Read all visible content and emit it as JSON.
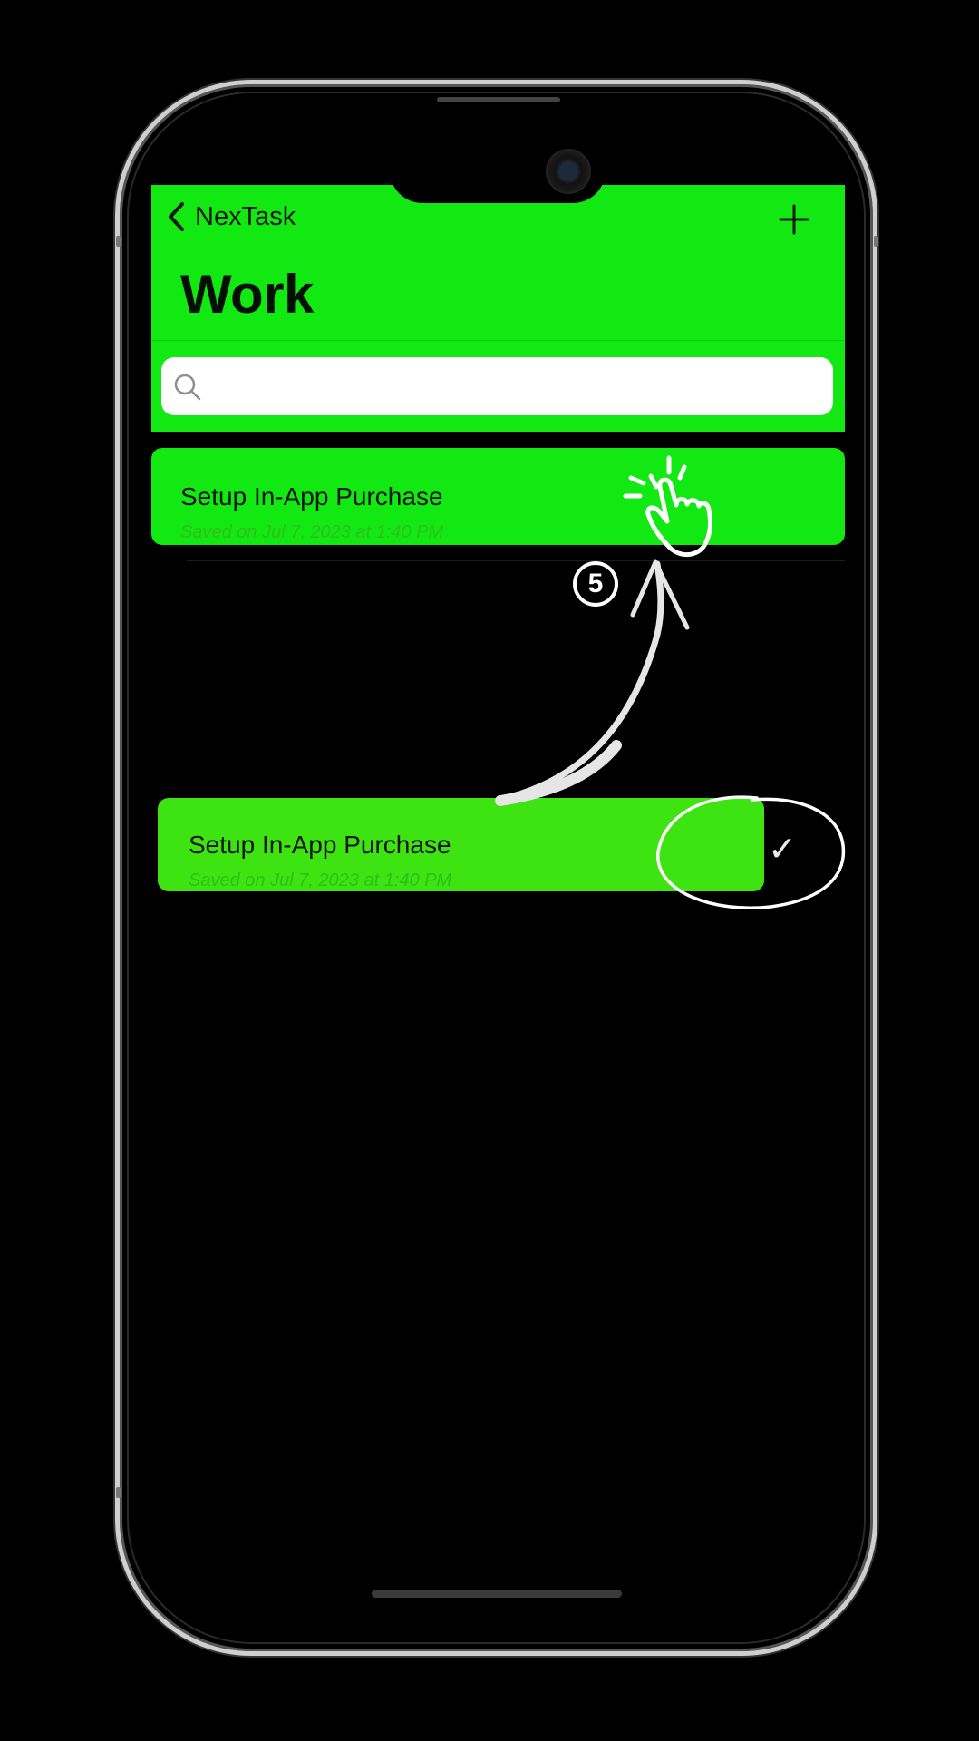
{
  "nav": {
    "back_label": "NexTask",
    "back_icon": "chevron-left-icon",
    "add_icon": "plus-icon"
  },
  "page": {
    "title": "Work"
  },
  "search": {
    "placeholder": "",
    "value": "",
    "icon": "search-icon"
  },
  "tasks": [
    {
      "title": "Setup In-App Purchase",
      "subtitle": "Saved on Jul 7, 2023 at 1:40 PM"
    },
    {
      "title": "Setup In-App Purchase",
      "subtitle": "Saved on Jul 7, 2023 at 1:40 PM",
      "swipe_action_icon": "checkmark-icon"
    }
  ],
  "annotation": {
    "step_number": "5",
    "gesture_icon": "tap-hand-icon"
  },
  "colors": {
    "accent": "#12e812",
    "swiped_row": "#3de411",
    "background": "#000000",
    "annotation": "#ffffff"
  }
}
